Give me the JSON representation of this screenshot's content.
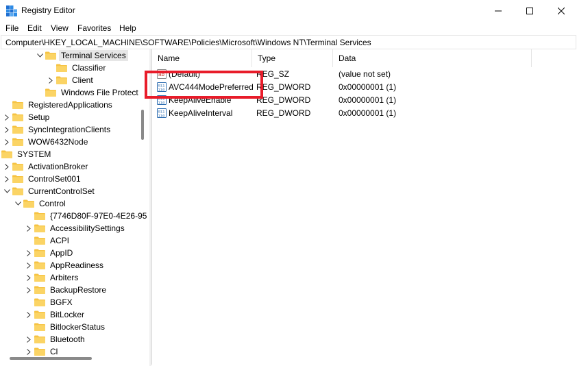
{
  "window": {
    "title": "Registry Editor"
  },
  "menu": [
    "File",
    "Edit",
    "View",
    "Favorites",
    "Help"
  ],
  "address": "Computer\\HKEY_LOCAL_MACHINE\\SOFTWARE\\Policies\\Microsoft\\Windows NT\\Terminal Services",
  "tree": [
    {
      "label": "Terminal Services",
      "state": "expanded",
      "selected": true
    },
    {
      "label": "Classifier",
      "state": "none"
    },
    {
      "label": "Client",
      "state": "collapsed"
    },
    {
      "label": "Windows File Protect",
      "state": "none"
    },
    {
      "label": "RegisteredApplications",
      "state": "none"
    },
    {
      "label": "Setup",
      "state": "collapsed"
    },
    {
      "label": "SyncIntegrationClients",
      "state": "collapsed"
    },
    {
      "label": "WOW6432Node",
      "state": "collapsed"
    },
    {
      "label": "SYSTEM",
      "state": "expanded"
    },
    {
      "label": "ActivationBroker",
      "state": "collapsed"
    },
    {
      "label": "ControlSet001",
      "state": "collapsed"
    },
    {
      "label": "CurrentControlSet",
      "state": "expanded"
    },
    {
      "label": "Control",
      "state": "expanded"
    },
    {
      "label": "{7746D80F-97E0-4E26-95",
      "state": "none"
    },
    {
      "label": "AccessibilitySettings",
      "state": "collapsed"
    },
    {
      "label": "ACPI",
      "state": "none"
    },
    {
      "label": "AppID",
      "state": "collapsed"
    },
    {
      "label": "AppReadiness",
      "state": "collapsed"
    },
    {
      "label": "Arbiters",
      "state": "collapsed"
    },
    {
      "label": "BackupRestore",
      "state": "collapsed"
    },
    {
      "label": "BGFX",
      "state": "none"
    },
    {
      "label": "BitLocker",
      "state": "collapsed"
    },
    {
      "label": "BitlockerStatus",
      "state": "none"
    },
    {
      "label": "Bluetooth",
      "state": "collapsed"
    },
    {
      "label": "Cl",
      "state": "collapsed"
    }
  ],
  "columns": [
    "Name",
    "Type",
    "Data"
  ],
  "values": [
    {
      "name": "(Default)",
      "type": "REG_SZ",
      "data": "(value not set)",
      "icon": "string-value-icon"
    },
    {
      "name": "AVC444ModePreferred",
      "type": "REG_DWORD",
      "data": "0x00000001 (1)",
      "icon": "binary-value-icon"
    },
    {
      "name": "KeepAliveEnable",
      "type": "REG_DWORD",
      "data": "0x00000001 (1)",
      "icon": "binary-value-icon"
    },
    {
      "name": "KeepAliveInterval",
      "type": "REG_DWORD",
      "data": "0x00000001 (1)",
      "icon": "binary-value-icon"
    }
  ],
  "colors": {
    "highlight": "#e81c2a",
    "folder": "#f6c343",
    "selected_bg": "#e6e6e6"
  }
}
